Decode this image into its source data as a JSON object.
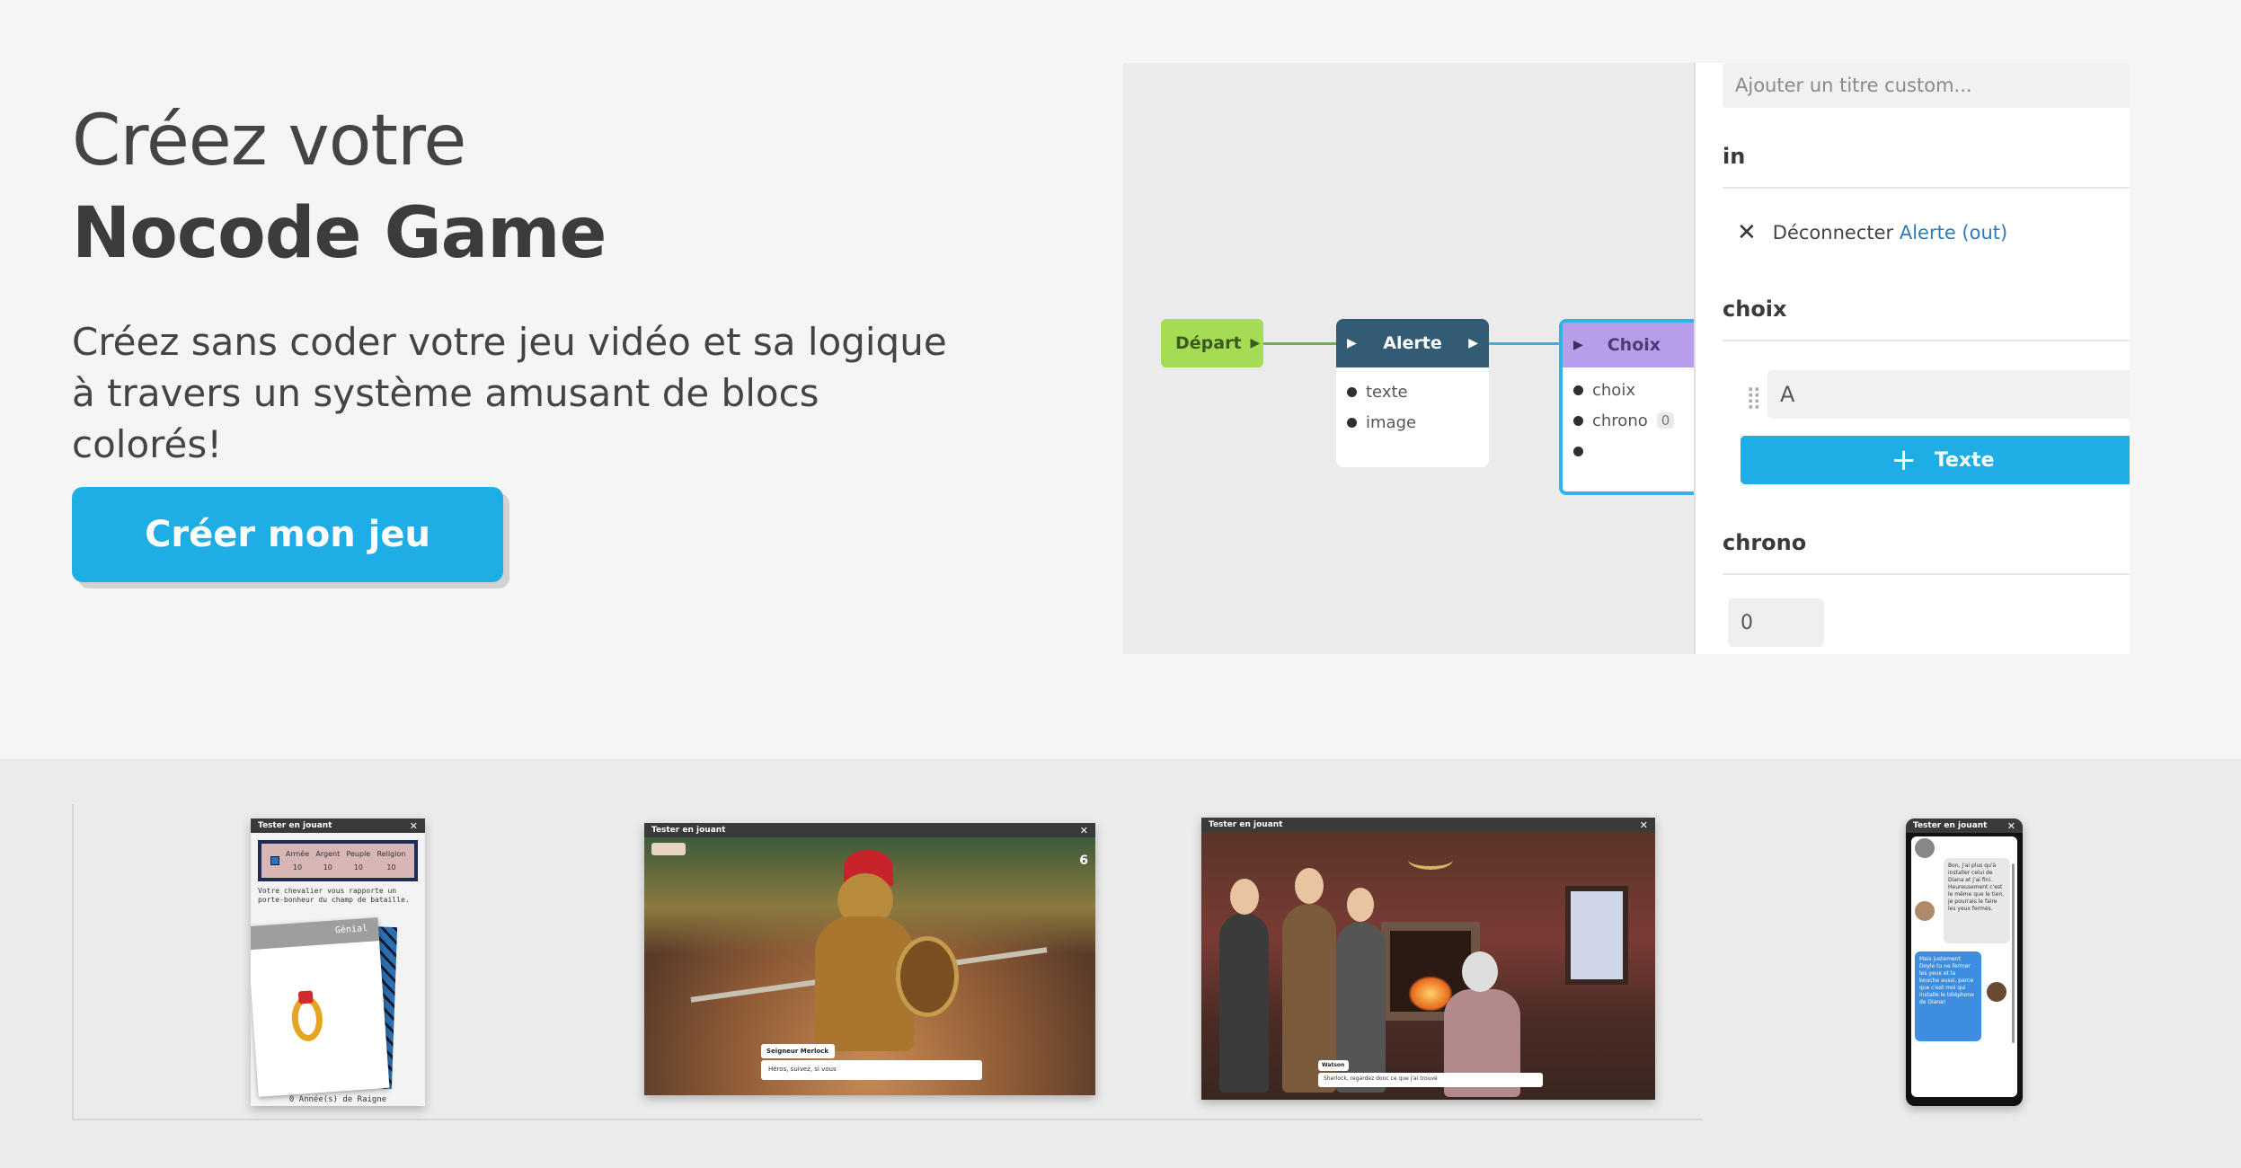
{
  "hero": {
    "title_line1": "Créez votre",
    "title_line2": "Nocode Game",
    "subtitle": "Créez sans coder votre jeu vidéo et sa logique à travers un système amusant de blocs colorés!",
    "cta_label": "Créer mon jeu"
  },
  "editor": {
    "nodes": {
      "depart": "Départ",
      "alerte": "Alerte",
      "alerte_ports": [
        "texte",
        "image"
      ],
      "choix": "Choix",
      "choix_ports": [
        "choix",
        "chrono"
      ],
      "chrono_count": "0"
    },
    "panel": {
      "title_placeholder": "Ajouter un titre custom...",
      "in_label": "in",
      "disconnect_text": "Déconnecter",
      "disconnect_target": "Alerte (out)",
      "choix_label": "choix",
      "choice_value": "A",
      "add_text_label": "Texte",
      "chrono_label": "chrono",
      "chrono_value": "0"
    }
  },
  "showcase": {
    "shot_title": "Tester en jouant",
    "reign": {
      "stats": [
        {
          "label": "Armée",
          "value": "10"
        },
        {
          "label": "Argent",
          "value": "10"
        },
        {
          "label": "Peuple",
          "value": "10"
        },
        {
          "label": "Religion",
          "value": "10"
        }
      ],
      "text": "Votre chevalier vous rapporte un porte-bonheur du champ de bataille.",
      "card_label": "Génial",
      "footer": "0 Année(s) de Raigne"
    },
    "knight": {
      "count": "6",
      "speaker": "Seigneur Merlock",
      "line": "Héros, suivez, si vous"
    },
    "sherlock": {
      "speaker": "Watson",
      "line": "Sherlock, regardez donc ce que j'ai trouvé"
    },
    "chat": {
      "msg1": "Bon, j'ai plus qu'à installer celui de Diana et j'ai fini. Heureusement c'est le même que le tien, je pourrais le faire les yeux fermés.",
      "msg2": "Mais justement Doyle tu ne fermer les yeux et la bouche aussi, parce que c'est moi qui installe le téléphone de Diana!"
    }
  }
}
